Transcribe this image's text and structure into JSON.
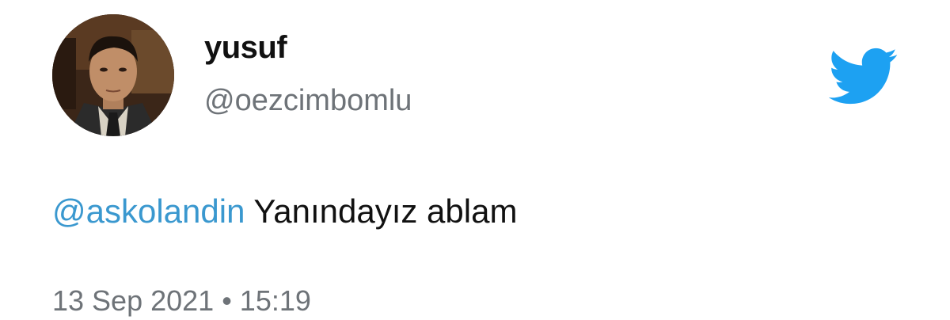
{
  "user": {
    "display_name": "yusuf",
    "handle": "@oezcimbomlu",
    "avatar_icon": "profile-photo"
  },
  "tweet": {
    "mention": "@askolandin",
    "text": " Yanındayız ablam"
  },
  "meta": {
    "date": "13 Sep 2021",
    "separator": " • ",
    "time": "15:19"
  },
  "brand": {
    "icon": "twitter-bird-icon",
    "color": "#1DA1F2"
  },
  "colors": {
    "mention": "#3a98cf",
    "secondary_text": "#6e7378"
  }
}
